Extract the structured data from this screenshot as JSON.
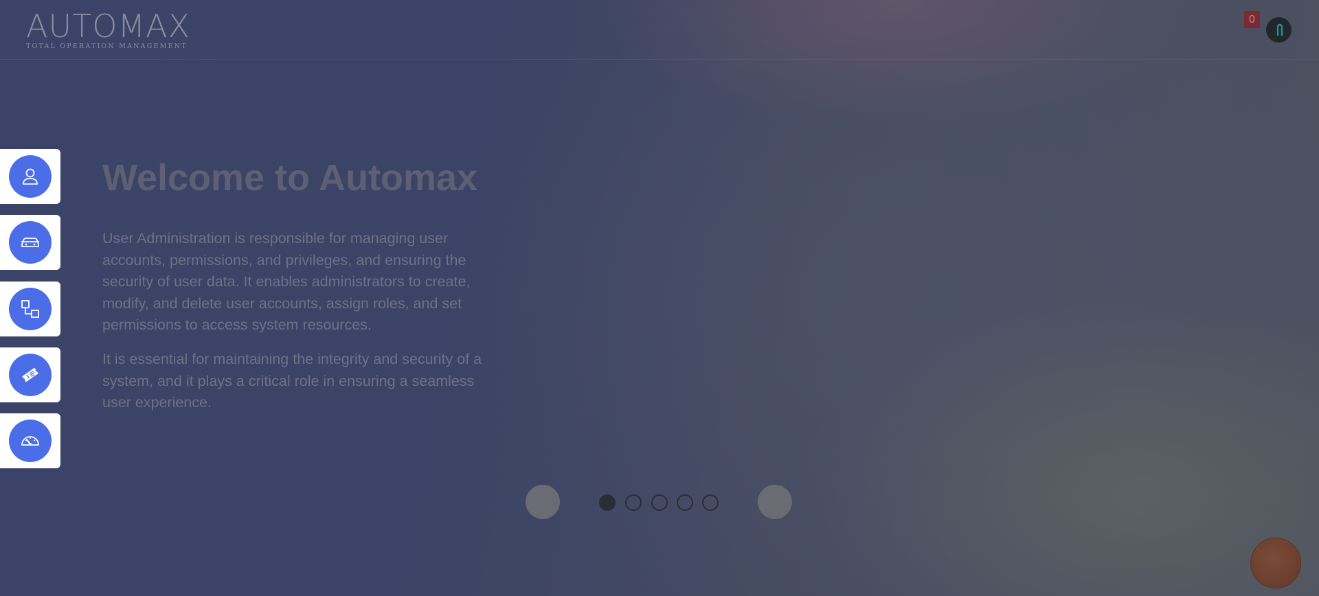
{
  "header": {
    "logo_text": "AUTOMAX",
    "logo_tagline": "TOTAL OPERATION MANAGEMENT",
    "notification_count": "0"
  },
  "sidenav": {
    "items": [
      {
        "icon": "user-icon"
      },
      {
        "icon": "car-icon"
      },
      {
        "icon": "workflow-icon"
      },
      {
        "icon": "ticket-icon"
      },
      {
        "icon": "speedometer-icon"
      }
    ]
  },
  "hero": {
    "title": "Welcome to Automax",
    "paragraph1": "User Administration is responsible for managing user accounts, permissions, and privileges, and ensuring the security of user data. It enables administrators to create, modify, and delete user accounts, assign roles, and set permissions to access system resources.",
    "paragraph2": "It is essential for maintaining the integrity and security of a system, and it plays a critical role in ensuring a seamless user experience."
  },
  "carousel": {
    "slide_count": 5,
    "active_index": 0
  },
  "colors": {
    "accent": "#4b6ee8",
    "badge": "#7a2a33",
    "fab": "#6f4232"
  }
}
